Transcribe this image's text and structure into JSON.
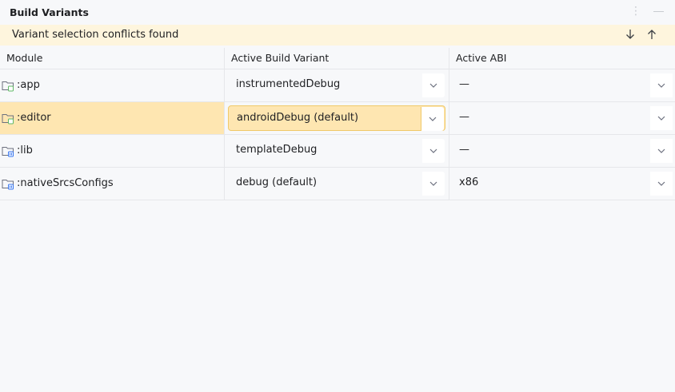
{
  "panel": {
    "title": "Build Variants",
    "actions": [
      "more-options",
      "minimize"
    ]
  },
  "banner": {
    "message": "Variant selection conflicts found",
    "next_label": "Next conflict",
    "prev_label": "Previous conflict",
    "background": "#fef5dd"
  },
  "table": {
    "columns": [
      "Module",
      "Active Build Variant",
      "Active ABI"
    ],
    "rows": [
      {
        "module": ":app",
        "module_icon": "module-folder-app-icon",
        "variant": "instrumentedDebug",
        "abi": "—",
        "selected": false
      },
      {
        "module": ":editor",
        "module_icon": "module-folder-app-icon",
        "variant": "androidDebug (default)",
        "abi": "—",
        "selected": true
      },
      {
        "module": ":lib",
        "module_icon": "module-folder-lib-icon",
        "variant": "templateDebug",
        "abi": "—",
        "selected": false
      },
      {
        "module": ":nativeSrcsConfigs",
        "module_icon": "module-folder-lib-icon",
        "variant": "debug (default)",
        "abi": "x86",
        "selected": false
      }
    ]
  },
  "colors": {
    "selection": "#fee6b1",
    "selection_border": "#f0c96a",
    "background": "#f7f8fa",
    "app_module_accent": "#5fb865",
    "lib_module_accent": "#3574f0"
  }
}
